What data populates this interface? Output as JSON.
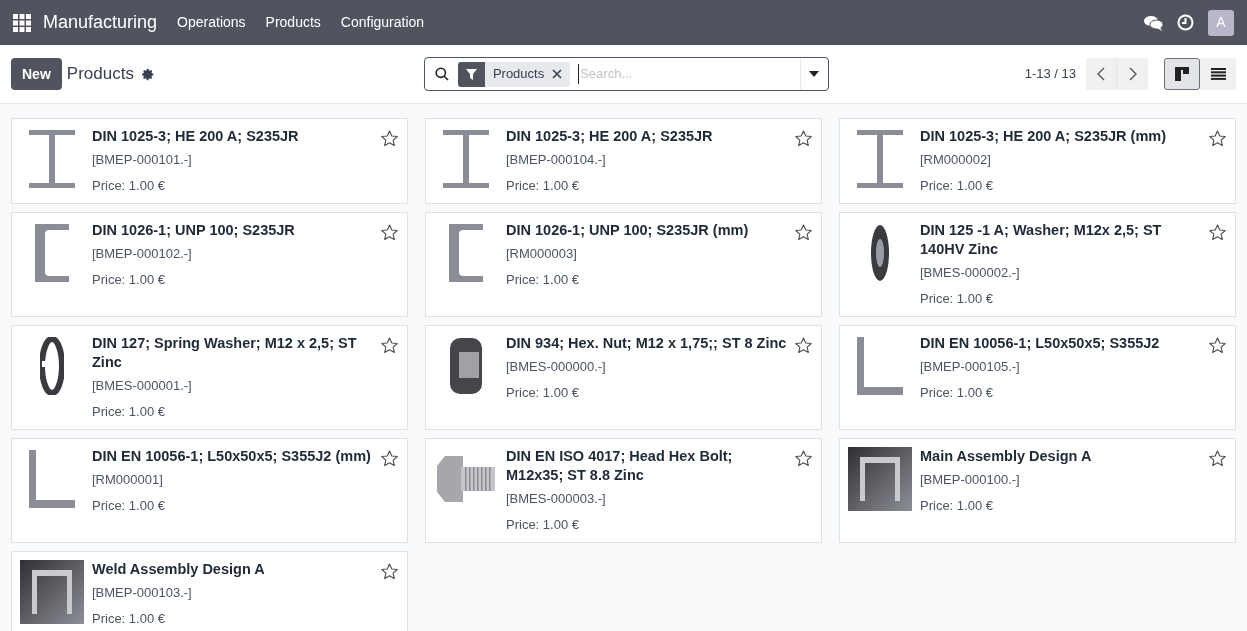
{
  "navbar": {
    "app_name": "Manufacturing",
    "menu": [
      "Operations",
      "Products",
      "Configuration"
    ],
    "avatar": "A"
  },
  "control_panel": {
    "new_button": "New",
    "title": "Products",
    "search": {
      "facet": "Products",
      "placeholder": "Search..."
    },
    "pager": "1-13 / 13",
    "views": [
      {
        "kind": "kanban",
        "selected": true
      },
      {
        "kind": "list",
        "selected": false
      }
    ]
  },
  "products": [
    {
      "name": "DIN 1025-3; HE 200 A; S235JR",
      "code": "[BMEP-000101.-]",
      "price": "Price: 1.00 €",
      "kind": "ibeam",
      "favorite": false
    },
    {
      "name": "DIN 1025-3; HE 200 A; S235JR",
      "code": "[BMEP-000104.-]",
      "price": "Price: 1.00 €",
      "kind": "ibeam",
      "favorite": false
    },
    {
      "name": "DIN 1025-3; HE 200 A; S235JR (mm)",
      "code": "[RM000002]",
      "price": "Price: 1.00 €",
      "kind": "ibeam",
      "favorite": false
    },
    {
      "name": "DIN 1026-1; UNP 100; S235JR",
      "code": "[BMEP-000102.-]",
      "price": "Price: 1.00 €",
      "kind": "channel",
      "favorite": false
    },
    {
      "name": "DIN 1026-1; UNP 100; S235JR (mm)",
      "code": "[RM000003]",
      "price": "Price: 1.00 €",
      "kind": "channel",
      "favorite": false
    },
    {
      "name": "DIN 125 -1 A; Washer; M12x 2,5; ST 140HV Zinc",
      "code": "[BMES-000002.-]",
      "price": "Price: 1.00 €",
      "kind": "washer",
      "favorite": false
    },
    {
      "name": "DIN 127; Spring Washer; M12 x 2,5; ST Zinc",
      "code": "[BMES-000001.-]",
      "price": "Price: 1.00 €",
      "kind": "spring",
      "favorite": false
    },
    {
      "name": "DIN 934; Hex. Nut; M12 x 1,75;; ST 8 Zinc",
      "code": "[BMES-000000.-]",
      "price": "Price: 1.00 €",
      "kind": "nut",
      "favorite": false
    },
    {
      "name": "DIN EN 10056-1; L50x50x5; S355J2",
      "code": "[BMEP-000105.-]",
      "price": "Price: 1.00 €",
      "kind": "angle",
      "favorite": false
    },
    {
      "name": "DIN EN 10056-1; L50x50x5; S355J2 (mm)",
      "code": "[RM000001]",
      "price": "Price: 1.00 €",
      "kind": "angle",
      "favorite": false
    },
    {
      "name": "DIN EN ISO 4017; Head Hex Bolt; M12x35; ST 8.8 Zinc",
      "code": "[BMES-000003.-]",
      "price": "Price: 1.00 €",
      "kind": "bolt",
      "favorite": false
    },
    {
      "name": "Main Assembly Design A",
      "code": "[BMEP-000100.-]",
      "price": "Price: 1.00 €",
      "kind": "assembly",
      "favorite": false
    },
    {
      "name": "Weld Assembly Design A",
      "code": "[BMEP-000103.-]",
      "price": "Price: 1.00 €",
      "kind": "assembly",
      "favorite": false
    }
  ]
}
